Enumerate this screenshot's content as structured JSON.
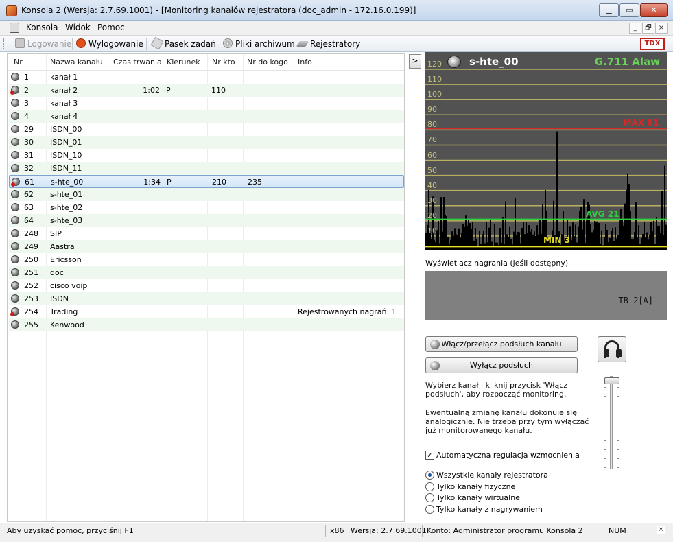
{
  "window": {
    "title": "Konsola 2 (Wersja:  2.7.69.1001) - [Monitoring kanałów rejestratora (doc_admin - 172.16.0.199)]",
    "minimize": "▁",
    "maximize": "▭",
    "close": "✕"
  },
  "menu": {
    "items": [
      "Konsola",
      "Widok",
      "Pomoc"
    ],
    "mdi_min": "_",
    "mdi_restore": "🗗",
    "mdi_close": "×"
  },
  "toolbar": {
    "login": "Logowanie",
    "logout": "Wylogowanie",
    "taskbar": "Pasek zadań",
    "archive": "Pliki archiwum",
    "recorders": "Rejestratory",
    "logo": "TDX"
  },
  "table": {
    "columns": [
      "Nr",
      "Nazwa kanału",
      "Czas trwania",
      "Kierunek",
      "Nr kto",
      "Nr do kogo",
      "Info"
    ],
    "rows": [
      {
        "nr": "1",
        "name": "kanał 1",
        "dur": "",
        "dir": "",
        "from": "",
        "to": "",
        "info": "",
        "rec": false
      },
      {
        "nr": "2",
        "name": "kanał 2",
        "dur": "1:02",
        "dir": "P",
        "from": "110",
        "to": "",
        "info": "",
        "rec": true
      },
      {
        "nr": "3",
        "name": "kanał 3",
        "dur": "",
        "dir": "",
        "from": "",
        "to": "",
        "info": "",
        "rec": false
      },
      {
        "nr": "4",
        "name": "kanał 4",
        "dur": "",
        "dir": "",
        "from": "",
        "to": "",
        "info": "",
        "rec": false
      },
      {
        "nr": "29",
        "name": "ISDN_00",
        "dur": "",
        "dir": "",
        "from": "",
        "to": "",
        "info": "",
        "rec": false
      },
      {
        "nr": "30",
        "name": "ISDN_01",
        "dur": "",
        "dir": "",
        "from": "",
        "to": "",
        "info": "",
        "rec": false
      },
      {
        "nr": "31",
        "name": "ISDN_10",
        "dur": "",
        "dir": "",
        "from": "",
        "to": "",
        "info": "",
        "rec": false
      },
      {
        "nr": "32",
        "name": "ISDN_11",
        "dur": "",
        "dir": "",
        "from": "",
        "to": "",
        "info": "",
        "rec": false
      },
      {
        "nr": "61",
        "name": "s-hte_00",
        "dur": "1:34",
        "dir": "P",
        "from": "210",
        "to": "235",
        "info": "",
        "rec": true,
        "selected": true
      },
      {
        "nr": "62",
        "name": "s-hte_01",
        "dur": "",
        "dir": "",
        "from": "",
        "to": "",
        "info": "",
        "rec": false
      },
      {
        "nr": "63",
        "name": "s-hte_02",
        "dur": "",
        "dir": "",
        "from": "",
        "to": "",
        "info": "",
        "rec": false
      },
      {
        "nr": "64",
        "name": "s-hte_03",
        "dur": "",
        "dir": "",
        "from": "",
        "to": "",
        "info": "",
        "rec": false
      },
      {
        "nr": "248",
        "name": "SIP",
        "dur": "",
        "dir": "",
        "from": "",
        "to": "",
        "info": "",
        "rec": false
      },
      {
        "nr": "249",
        "name": "Aastra",
        "dur": "",
        "dir": "",
        "from": "",
        "to": "",
        "info": "",
        "rec": false
      },
      {
        "nr": "250",
        "name": "Ericsson",
        "dur": "",
        "dir": "",
        "from": "",
        "to": "",
        "info": "",
        "rec": false
      },
      {
        "nr": "251",
        "name": "doc",
        "dur": "",
        "dir": "",
        "from": "",
        "to": "",
        "info": "",
        "rec": false
      },
      {
        "nr": "252",
        "name": "cisco voip",
        "dur": "",
        "dir": "",
        "from": "",
        "to": "",
        "info": "",
        "rec": false
      },
      {
        "nr": "253",
        "name": "ISDN",
        "dur": "",
        "dir": "",
        "from": "",
        "to": "",
        "info": "",
        "rec": false
      },
      {
        "nr": "254",
        "name": "Trading",
        "dur": "",
        "dir": "",
        "from": "",
        "to": "",
        "info": "Rejestrowanych nagrań: 1",
        "rec": true
      },
      {
        "nr": "255",
        "name": "Kenwood",
        "dur": "",
        "dir": "",
        "from": "",
        "to": "",
        "info": "",
        "rec": false
      }
    ]
  },
  "panel": {
    "collapse": ">",
    "channel": "s-hte_00",
    "codec": "G.711 Alaw",
    "ticks": [
      "120",
      "110",
      "100",
      "90",
      "80",
      "70",
      "60",
      "50",
      "40",
      "30",
      "20",
      "10"
    ],
    "max_label": "MAX 81",
    "avg_label": "AVG 21",
    "min_label": "MIN 3",
    "levels": {
      "max": 81,
      "avg": 21,
      "min": 3,
      "ymin": 0,
      "ymax": 125
    },
    "recording_label": "Wyświetlacz nagrania (jeśli dostępny)",
    "recording_text": "TB 2[A]",
    "btn_listen": "Włącz/przełącz podsłuch kanału",
    "btn_stop": "Wyłącz podsłuch",
    "help1": "Wybierz kanał i kliknij przycisk 'Włącz podsłuch', aby rozpocząć monitoring.",
    "help2": "Ewentualną zmianę kanału dokonuje się analogicznie. Nie trzeba przy tym wyłączać już monitorowanego kanału.",
    "agc_label": "Automatyczna regulacja wzmocnienia",
    "agc_checked": true,
    "radios": [
      {
        "label": "Wszystkie kanały rejestratora",
        "checked": true
      },
      {
        "label": "Tylko kanały fizyczne",
        "checked": false
      },
      {
        "label": "Tylko kanały wirtualne",
        "checked": false
      },
      {
        "label": "Tylko kanały z nagrywaniem",
        "checked": false
      }
    ],
    "volume": 0.95
  },
  "status": {
    "help": "Aby uzyskać pomoc, przyciśnij F1",
    "arch": "x86",
    "version": "Wersja: 2.7.69.1001",
    "account": "Konto: Administrator programu Konsola 2",
    "num": "NUM",
    "close": "×"
  },
  "colors": {
    "max_line": "#d02a2a",
    "avg_line": "#2ad040",
    "min_line": "#e8e020",
    "grid": "#b8b060",
    "signal": "#000000"
  }
}
